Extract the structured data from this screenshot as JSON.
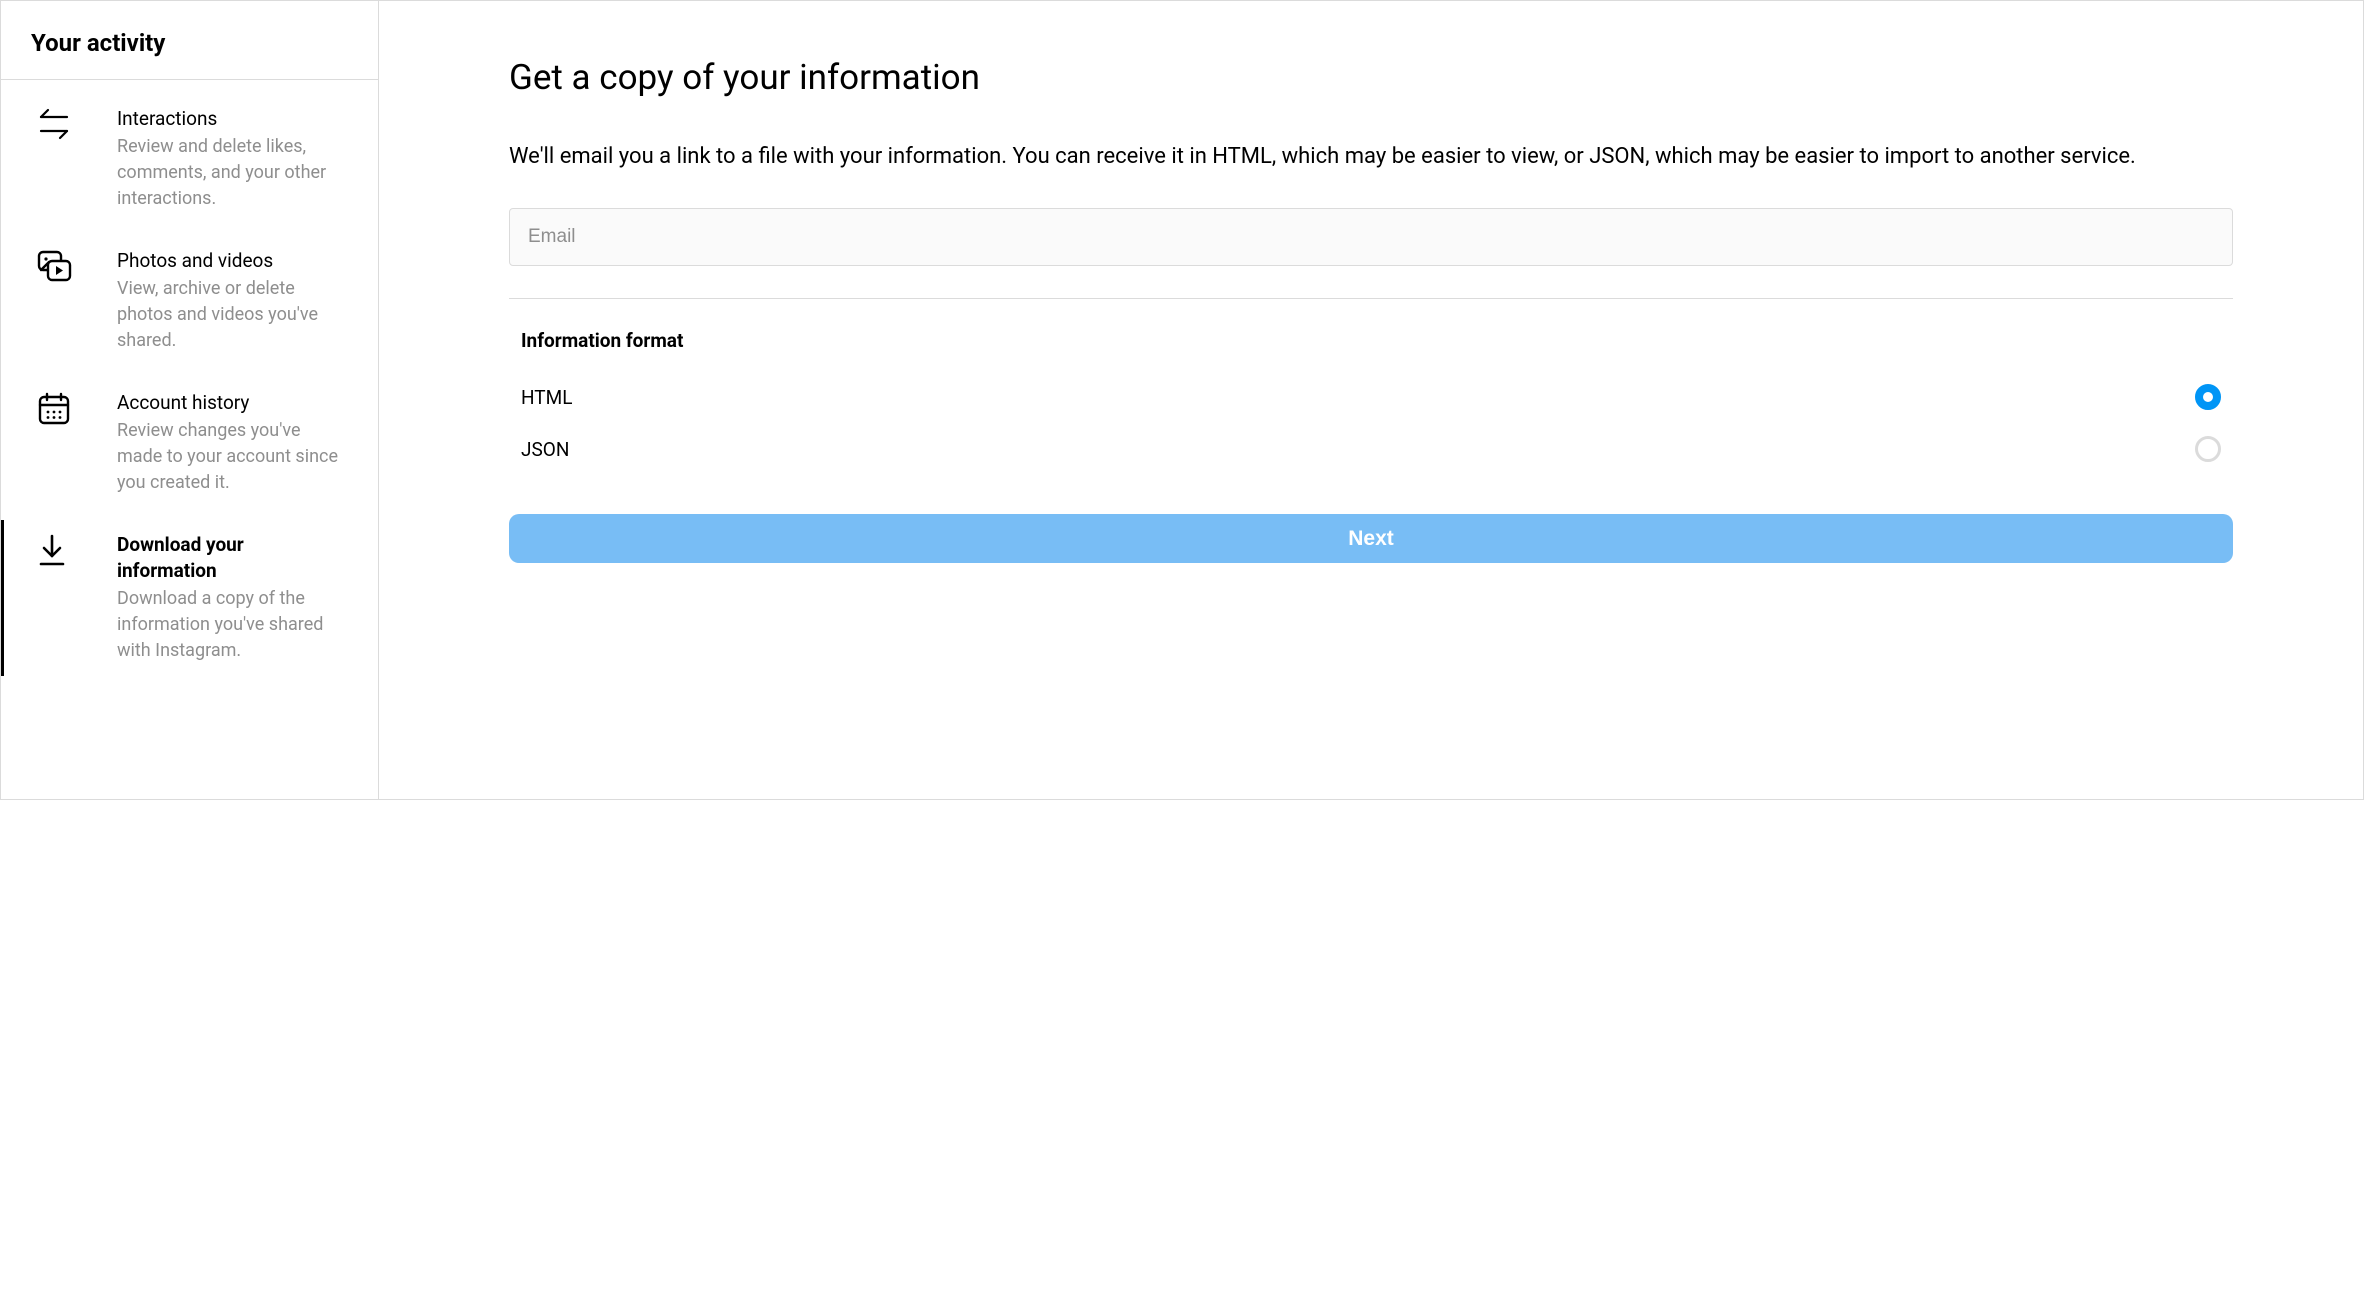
{
  "sidebar": {
    "title": "Your activity",
    "items": [
      {
        "id": "interactions",
        "title": "Interactions",
        "desc": "Review and delete likes, comments, and your other interactions.",
        "active": false
      },
      {
        "id": "photos-videos",
        "title": "Photos and videos",
        "desc": "View, archive or delete photos and videos you've shared.",
        "active": false
      },
      {
        "id": "account-history",
        "title": "Account history",
        "desc": "Review changes you've made to your account since you created it.",
        "active": false
      },
      {
        "id": "download-info",
        "title": "Download your information",
        "desc": "Download a copy of the information you've shared with Instagram.",
        "active": true
      }
    ]
  },
  "main": {
    "title": "Get a copy of your information",
    "desc": "We'll email you a link to a file with your information. You can receive it in HTML, which may be easier to view, or JSON, which may be easier to import to another service.",
    "email_placeholder": "Email",
    "email_value": "",
    "format_title": "Information format",
    "format_options": [
      {
        "label": "HTML",
        "selected": true
      },
      {
        "label": "JSON",
        "selected": false
      }
    ],
    "next_button": "Next"
  },
  "colors": {
    "accent": "#0095f6",
    "button": "#78bdf5",
    "border": "#dbdbdb",
    "muted": "#8e8e8e"
  }
}
